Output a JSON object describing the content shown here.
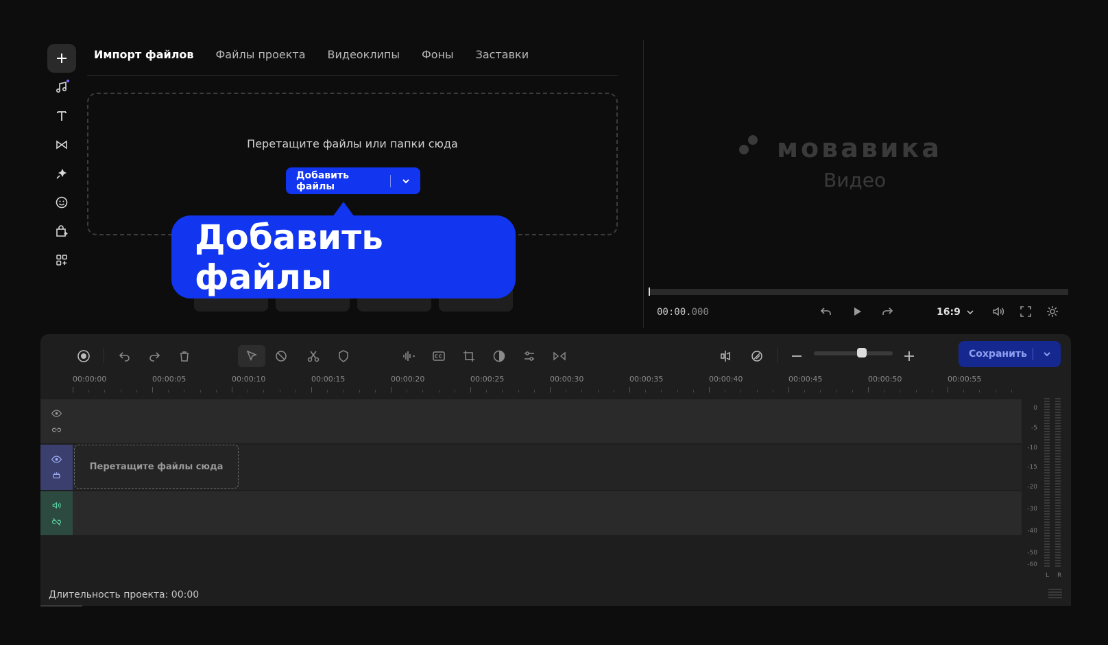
{
  "tabs": {
    "import": "Импорт файлов",
    "project_files": "Файлы проекта",
    "video_clips": "Видеоклипы",
    "backgrounds": "Фоны",
    "intros": "Заставки"
  },
  "rail_icons": [
    "plus-icon",
    "music-icon",
    "text-icon",
    "transitions-icon",
    "effects-icon",
    "stickers-icon",
    "store-icon",
    "more-apps-icon"
  ],
  "dropzone": {
    "text": "Перетащите файлы или папки сюда",
    "button": "Добавить файлы"
  },
  "callout": {
    "text": "Добавить файлы"
  },
  "preview": {
    "logo_name": "мовавика",
    "logo_sub": "Видео",
    "timecode_main": "00:00.",
    "timecode_ms": "000",
    "aspect": "16:9"
  },
  "toolbar": {
    "save": "Сохранить"
  },
  "ruler": {
    "labels": [
      "00:00:00",
      "00:00:05",
      "00:00:10",
      "00:00:15",
      "00:00:20",
      "00:00:25",
      "00:00:30",
      "00:00:35",
      "00:00:40",
      "00:00:45",
      "00:00:50",
      "00:00:55"
    ]
  },
  "timeline": {
    "drop_clip": "Перетащите файлы сюда",
    "duration": "Длительность проекта: 00:00"
  },
  "meter": {
    "labels": [
      "0",
      "-5",
      "-10",
      "-15",
      "-20",
      "-30",
      "-40",
      "-50",
      "-60"
    ],
    "left": "L",
    "right": "R"
  },
  "colors": {
    "accent": "#1235f0",
    "background": "#0d0d0d",
    "panel": "#1e1e1e",
    "track": "#2a2a2a",
    "video_track_head": "#3a3f6e",
    "audio_track_head": "#2c4a40"
  }
}
